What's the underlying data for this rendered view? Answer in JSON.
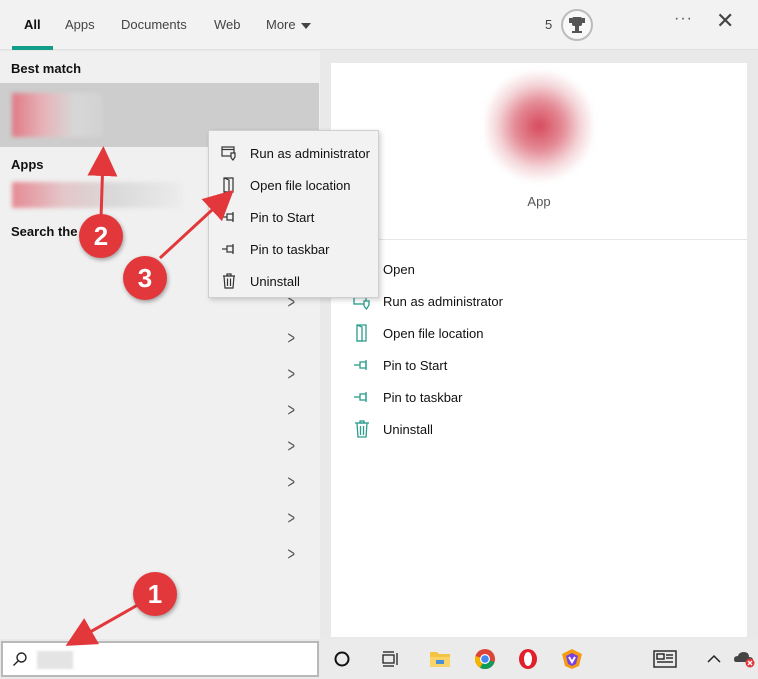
{
  "tabs": [
    {
      "label": "All",
      "active": true
    },
    {
      "label": "Apps",
      "active": false
    },
    {
      "label": "Documents",
      "active": false
    },
    {
      "label": "Web",
      "active": false
    },
    {
      "label": "More",
      "active": false
    }
  ],
  "header": {
    "points": "5",
    "more_icon": "ellipsis-icon",
    "close_icon": "close-icon"
  },
  "left": {
    "best_match_label": "Best match",
    "apps_label": "Apps",
    "search_web_label": "Search the w"
  },
  "context_menu": {
    "items": [
      {
        "label": "Run as administrator",
        "icon": "shield-window-icon"
      },
      {
        "label": "Open file location",
        "icon": "folder-icon"
      },
      {
        "label": "Pin to Start",
        "icon": "pin-icon"
      },
      {
        "label": "Pin to taskbar",
        "icon": "pin-icon"
      },
      {
        "label": "Uninstall",
        "icon": "trash-icon"
      }
    ]
  },
  "right": {
    "app_name": "App",
    "actions": [
      {
        "label": "Open",
        "icon": "open-icon"
      },
      {
        "label": "Run as administrator",
        "icon": "shield-window-icon"
      },
      {
        "label": "Open file location",
        "icon": "folder-icon"
      },
      {
        "label": "Pin to Start",
        "icon": "pin-icon"
      },
      {
        "label": "Pin to taskbar",
        "icon": "pin-icon"
      },
      {
        "label": "Uninstall",
        "icon": "trash-icon"
      }
    ]
  },
  "search": {
    "icon": "search-icon",
    "value": ""
  },
  "taskbar": {
    "items": [
      "cortana-icon",
      "task-view-icon",
      "file-explorer-icon",
      "chrome-icon",
      "opera-icon",
      "avast-browser-icon",
      "news-icon",
      "chevron-up-icon",
      "onedrive-error-icon"
    ]
  },
  "annotations": {
    "badge_1": "1",
    "badge_2": "2",
    "badge_3": "3"
  },
  "colors": {
    "accent": "#0e9e8a",
    "badge": "#e2383c",
    "icon_teal": "#2b9c8c"
  }
}
